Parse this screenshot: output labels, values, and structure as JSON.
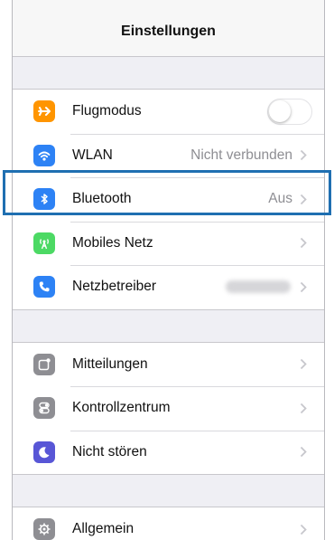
{
  "navbar": {
    "title": "Einstellungen"
  },
  "groups": [
    {
      "rows": [
        {
          "label": "Flugmodus",
          "icon": "airplane-icon",
          "color": "#ff9500",
          "toggle": false
        },
        {
          "label": "WLAN",
          "value": "Nicht verbunden",
          "icon": "wifi-icon",
          "color": "#2d82f5"
        },
        {
          "label": "Bluetooth",
          "value": "Aus",
          "icon": "bluetooth-icon",
          "color": "#2d82f5"
        },
        {
          "label": "Mobiles Netz",
          "icon": "antenna-icon",
          "color": "#4cd964"
        },
        {
          "label": "Netzbetreiber",
          "icon": "phone-icon",
          "color": "#2d82f5"
        }
      ]
    },
    {
      "rows": [
        {
          "label": "Mitteilungen",
          "icon": "notifications-icon",
          "color": "#8e8e93"
        },
        {
          "label": "Kontrollzentrum",
          "icon": "switches-icon",
          "color": "#8e8e93"
        },
        {
          "label": "Nicht stören",
          "icon": "moon-icon",
          "color": "#5856d6"
        }
      ]
    },
    {
      "rows": [
        {
          "label": "Allgemein",
          "icon": "gear-icon",
          "color": "#8e8e93"
        }
      ]
    }
  ],
  "highlight": {
    "target": "Bluetooth",
    "color": "#1f6fb1"
  }
}
